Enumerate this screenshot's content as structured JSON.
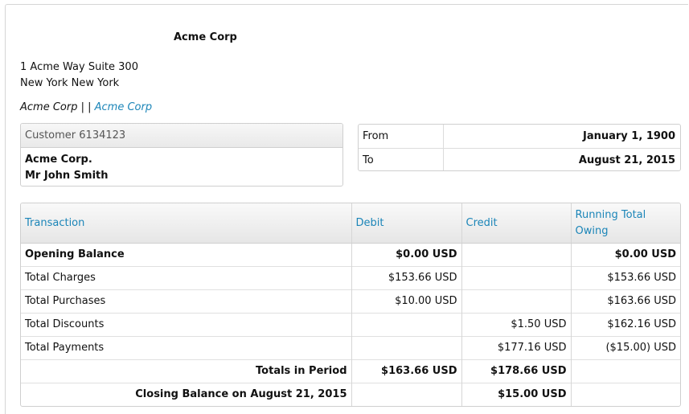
{
  "header": {
    "company": "Acme Corp",
    "address_line1": "1 Acme Way Suite 300",
    "address_line2": "New York New York",
    "subline_text": "Acme Corp | |",
    "subline_link": "Acme Corp"
  },
  "customer": {
    "label": "Customer 6134123",
    "name": "Acme Corp.",
    "contact": "Mr John Smith"
  },
  "range": {
    "from_label": "From",
    "from_value": "January 1, 1900",
    "to_label": "To",
    "to_value": "August 21, 2015"
  },
  "table": {
    "headers": [
      "Transaction",
      "Debit",
      "Credit",
      "Running Total Owing"
    ],
    "rows": [
      {
        "transaction": "Opening Balance",
        "debit": "$0.00 USD",
        "credit": "",
        "running": "$0.00 USD"
      },
      {
        "transaction": "Total Charges",
        "debit": "$153.66 USD",
        "credit": "",
        "running": "$153.66 USD"
      },
      {
        "transaction": "Total Purchases",
        "debit": "$10.00 USD",
        "credit": "",
        "running": "$163.66 USD"
      },
      {
        "transaction": "Total Discounts",
        "debit": "",
        "credit": "$1.50 USD",
        "running": "$162.16 USD"
      },
      {
        "transaction": "Total Payments",
        "debit": "",
        "credit": "$177.16 USD",
        "running": "($15.00) USD"
      }
    ],
    "totals": {
      "label": "Totals in Period",
      "debit": "$163.66 USD",
      "credit": "$178.66 USD",
      "running": ""
    },
    "closing": {
      "label": "Closing Balance on August 21, 2015",
      "debit": "",
      "credit": "$15.00 USD",
      "running": ""
    }
  },
  "colors": {
    "link": "#1b85b8"
  }
}
